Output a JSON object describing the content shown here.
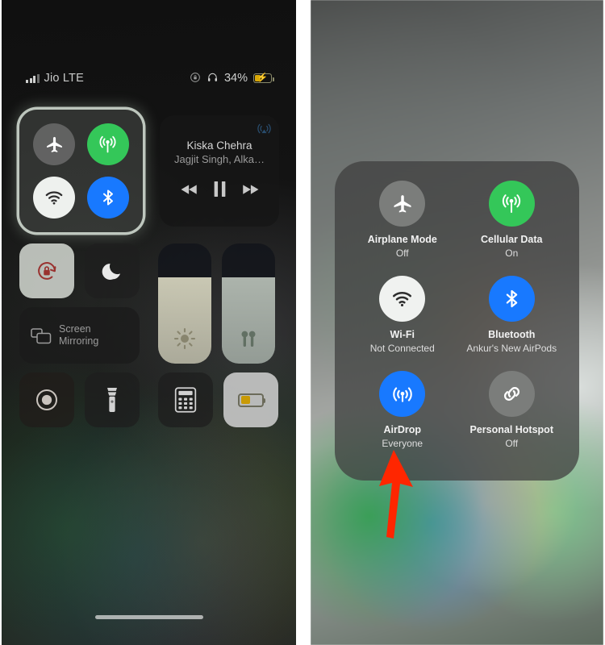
{
  "left_panel": {
    "status_bar": {
      "signal_icon": "cellular-bars-icon",
      "carrier": "Jio LTE",
      "rotation_lock_icon": "rotation-lock-icon",
      "headphones_icon": "headphones-icon",
      "battery_percent": "34%",
      "battery_icon": "battery-charging-icon",
      "battery_level": 34
    },
    "connectivity_module": {
      "highlighted": true,
      "toggles": [
        {
          "name": "Airplane Mode",
          "icon": "airplane-icon",
          "state": "off",
          "color": "#808080"
        },
        {
          "name": "Cellular Data",
          "icon": "cellular-icon",
          "state": "on",
          "color": "#34c759"
        },
        {
          "name": "Wi-Fi",
          "icon": "wifi-icon",
          "state": "on",
          "color": "#eef1ee"
        },
        {
          "name": "Bluetooth",
          "icon": "bluetooth-icon",
          "state": "on",
          "color": "#1879ff"
        }
      ]
    },
    "media_widget": {
      "title": "Kiska Chehra",
      "artist": "Jagjit Singh, Alka…",
      "airplay_icon": "airplay-audio-icon",
      "rewind_label": "rewind-icon",
      "pause_label": "pause-icon",
      "forward_label": "fast-forward-icon"
    },
    "toggles": {
      "rotation_lock": {
        "icon": "rotation-lock-icon",
        "state": "on"
      },
      "do_not_disturb": {
        "icon": "moon-icon",
        "state": "off"
      },
      "screen_mirroring": {
        "icon": "screen-mirroring-icon",
        "label_line1": "Screen",
        "label_line2": "Mirroring"
      },
      "brightness": {
        "icon": "brightness-icon",
        "level": 72
      },
      "volume": {
        "icon": "airpods-icon",
        "level": 72
      },
      "screen_record": {
        "icon": "screen-record-icon",
        "state": "off"
      },
      "flashlight": {
        "icon": "flashlight-icon",
        "state": "off"
      },
      "calculator": {
        "icon": "calculator-icon"
      },
      "low_power_mode": {
        "icon": "battery-icon",
        "state": "on"
      }
    }
  },
  "right_panel": {
    "expanded_connectivity": {
      "items": [
        {
          "icon": "airplane-icon",
          "title": "Airplane Mode",
          "subtitle": "Off",
          "color": "#7b7d7b",
          "active": false
        },
        {
          "icon": "cellular-icon",
          "title": "Cellular Data",
          "subtitle": "On",
          "color": "#34c759",
          "active": true
        },
        {
          "icon": "wifi-icon",
          "title": "Wi-Fi",
          "subtitle": "Not Connected",
          "color": "#f0f2f0",
          "active": false
        },
        {
          "icon": "bluetooth-icon",
          "title": "Bluetooth",
          "subtitle": "Ankur's New AirPods",
          "color": "#1879ff",
          "active": true
        },
        {
          "icon": "airdrop-icon",
          "title": "AirDrop",
          "subtitle": "Everyone",
          "color": "#1879ff",
          "active": true
        },
        {
          "icon": "hotspot-icon",
          "title": "Personal Hotspot",
          "subtitle": "Off",
          "color": "#7b7d7b",
          "active": false
        }
      ]
    },
    "annotation": {
      "arrow_icon": "red-up-arrow-icon",
      "arrow_color": "#FF2600",
      "points_at": "AirDrop"
    }
  }
}
